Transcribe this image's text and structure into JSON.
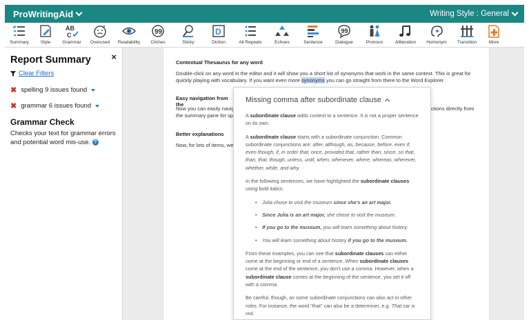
{
  "app": {
    "brand": "ProWritingAid",
    "writing_style": "Writing Style : General"
  },
  "toolbar": [
    {
      "label": "Summary",
      "icon": "summary-icon"
    },
    {
      "label": "Style",
      "icon": "style-icon"
    },
    {
      "label": "Grammar",
      "icon": "grammar-icon"
    },
    {
      "label": "Overused",
      "icon": "overused-icon"
    },
    {
      "label": "Readability",
      "icon": "readability-icon"
    },
    {
      "label": "Cliches",
      "icon": "cliches-icon"
    },
    {
      "label": "Sticky",
      "icon": "sticky-icon"
    },
    {
      "label": "Diction",
      "icon": "diction-icon"
    },
    {
      "label": "All Repeats",
      "icon": "all-repeats-icon"
    },
    {
      "label": "Echoes",
      "icon": "echoes-icon"
    },
    {
      "label": "Sentence",
      "icon": "sentence-icon"
    },
    {
      "label": "Dialogue",
      "icon": "dialogue-icon"
    },
    {
      "label": "Pronoun",
      "icon": "pronoun-icon"
    },
    {
      "label": "Alliteration",
      "icon": "alliteration-icon"
    },
    {
      "label": "Homonym",
      "icon": "homonym-icon"
    },
    {
      "label": "Transition",
      "icon": "transition-icon"
    },
    {
      "label": "More",
      "icon": "more-icon"
    }
  ],
  "sidebar": {
    "title": "Report Summary",
    "close": "×",
    "clear_filters": "Clear Filters",
    "issues": [
      {
        "label": "spelling 9 issues found"
      },
      {
        "label": "grammar 6 issues found"
      }
    ],
    "grammar_title": "Grammar Check",
    "grammar_text": "Checks your text for grammar errors and potential word mis-use.",
    "help": "?"
  },
  "document": {
    "p1_head": "Contextual Thesaurus for any word",
    "p1_text_a": "Double-click on any word in the editor and it will show you a short list of synonyms that work in the same context. This is great for quickly playing with vocabulary. If you want even more ",
    "p1_highlight": "synonyms",
    "p1_text_b": " you can go straight from there to the Word Explorer.",
    "p2_head": "Easy navigation from the",
    "p2_text": "Now you can easily navig the summary pane for sp",
    "p2_right": "ctions directly from",
    "p3_head": "Better explanations",
    "p3_text": "Now, for lots of items, we"
  },
  "popup": {
    "title": "Missing comma after subordinate clause",
    "p1_a": "A ",
    "p1_b": "subordinate clause",
    "p1_c": " adds context to a sentence. It is not a proper sentence on its own.",
    "p2_a": "A ",
    "p2_b": "subordinate clause",
    "p2_c": " starts with a subordinate conjunction. Common subordinate conjunctions are: ",
    "p2_d": "after, although, as, because, before, even if, even though, if, in order that, once, provided that, rather than, since, so that, than, that, though, unless, until, when, whenever, where, whereas, wherever, whether, while, and why.",
    "p3_a": "In the following sentences, we have highlighted the ",
    "p3_b": "subordinate clauses",
    "p3_c": " using bold italics.",
    "ex1_a": "Julia chose to visit the museum ",
    "ex1_b": "since she's an art major.",
    "ex2_a": "Since Julia is an art major,",
    "ex2_b": " she chose to visit the museum.",
    "ex3_a": "If you go to the museum,",
    "ex3_b": " you will learn something about history.",
    "ex4_a": "You will learn something about history ",
    "ex4_b": "if you go to the museum.",
    "p4_a": "From these examples, you can see that ",
    "p4_b": "subordinate clauses",
    "p4_c": " can either come at the beginning or end of a sentence. When ",
    "p4_d": "subordinate clauses",
    "p4_e": " come at the end of the sentence, you don't use a comma. However, when a ",
    "p4_f": "subordinate clause",
    "p4_g": " comes at the beginning of the sentence, you set it off with a comma.",
    "p5_a": "Be careful, though, as some subordinate conjunctions can also act in other roles. For instance, the word \"that\" can also be a determiner, e.g. ",
    "p5_b": "That car is red."
  },
  "colors": {
    "header_bg": "#1b8782",
    "link": "#1a6ac9",
    "error_x": "#c8342a",
    "highlight": "#c3d3e8"
  }
}
